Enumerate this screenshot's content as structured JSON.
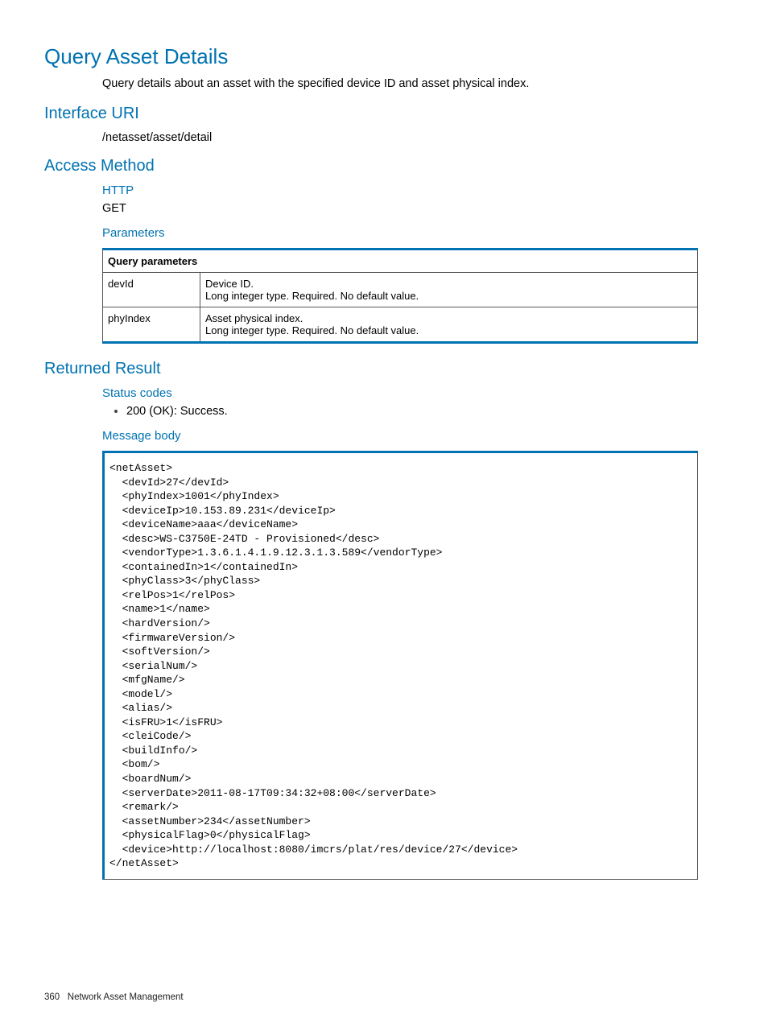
{
  "title": "Query Asset Details",
  "description": "Query details about an asset with the specified device ID and asset physical index.",
  "section_interface_uri": "Interface URI",
  "interface_uri": "/netasset/asset/detail",
  "section_access_method": "Access Method",
  "http_label": "HTTP",
  "http_method": "GET",
  "parameters_label": "Parameters",
  "params_table": {
    "header": "Query parameters",
    "rows": [
      {
        "name": "devId",
        "desc": "Device ID.\nLong integer type. Required. No default value."
      },
      {
        "name": "phyIndex",
        "desc": "Asset physical index.\nLong integer type. Required. No default value."
      }
    ]
  },
  "section_returned_result": "Returned Result",
  "status_codes_label": "Status codes",
  "status_items": [
    "200 (OK): Success."
  ],
  "message_body_label": "Message body",
  "code": "<netAsset>\n  <devId>27</devId>\n  <phyIndex>1001</phyIndex>\n  <deviceIp>10.153.89.231</deviceIp>\n  <deviceName>aaa</deviceName>\n  <desc>WS-C3750E-24TD - Provisioned</desc>\n  <vendorType>1.3.6.1.4.1.9.12.3.1.3.589</vendorType>\n  <containedIn>1</containedIn>\n  <phyClass>3</phyClass>\n  <relPos>1</relPos>\n  <name>1</name>\n  <hardVersion/>\n  <firmwareVersion/>\n  <softVersion/>\n  <serialNum/>\n  <mfgName/>\n  <model/>\n  <alias/>\n  <isFRU>1</isFRU>\n  <cleiCode/>\n  <buildInfo/>\n  <bom/>\n  <boardNum/>\n  <serverDate>2011-08-17T09:34:32+08:00</serverDate>\n  <remark/>\n  <assetNumber>234</assetNumber>\n  <physicalFlag>0</physicalFlag>\n  <device>http://localhost:8080/imcrs/plat/res/device/27</device>\n</netAsset>",
  "footer": {
    "page": "360",
    "label": "Network Asset Management"
  }
}
